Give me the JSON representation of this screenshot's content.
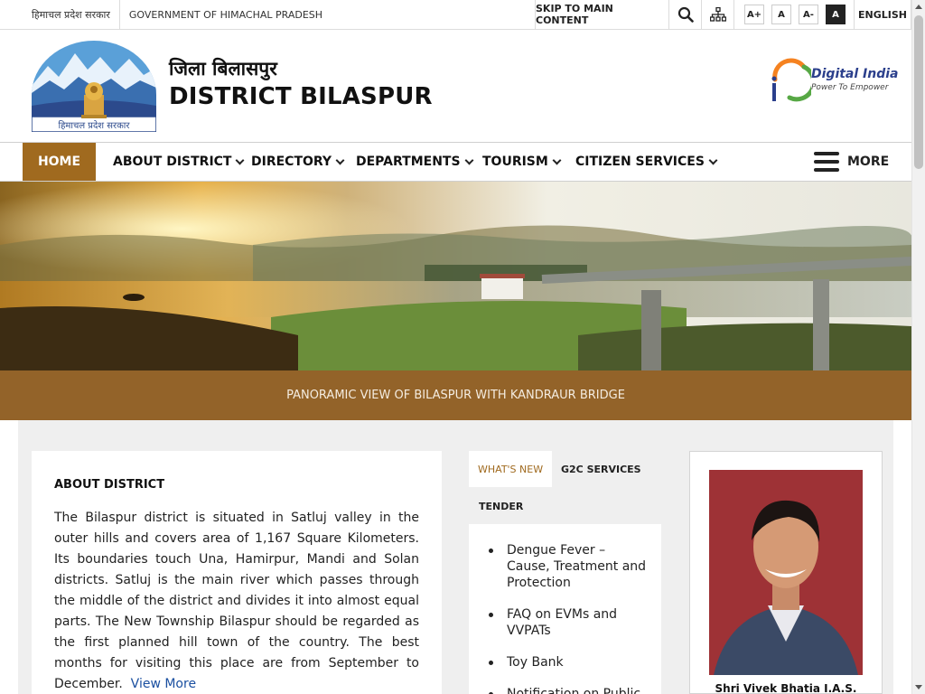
{
  "topbar": {
    "hp_govt_hindi": "हिमाचल प्रदेश सरकार",
    "govt_name": "GOVERNMENT OF HIMACHAL PRADESH",
    "skip_label": "SKIP TO MAIN CONTENT",
    "font_increase": "A+",
    "font_normal": "A",
    "font_decrease": "A-",
    "contrast": "A",
    "language": "ENGLISH"
  },
  "header": {
    "title_hindi": "जिला बिलासपुर",
    "title": "DISTRICT BILASPUR",
    "emblem_caption": "हिमाचल प्रदेश सरकार",
    "digital_india_title": "Digital India",
    "digital_india_tagline": "Power To Empower"
  },
  "nav": {
    "home": "HOME",
    "items": [
      "ABOUT DISTRICT",
      "DIRECTORY",
      "DEPARTMENTS",
      "TOURISM",
      "CITIZEN SERVICES"
    ],
    "more": "MORE"
  },
  "banner": {
    "caption": "PANORAMIC VIEW OF BILASPUR WITH KANDRAUR BRIDGE"
  },
  "about": {
    "heading": "ABOUT DISTRICT",
    "text": "The Bilaspur district is situated in Satluj valley in the outer hills and covers area of 1,167 Square Kilometers. Its boundaries touch Una, Hamirpur, Mandi and Solan districts. Satluj is the main river which passes through the middle of the district and divides it into almost equal parts. The New Township Bilaspur should be regarded as the first planned hill town of the country. The best months for visiting this place are from September to December.",
    "link": "View More"
  },
  "tabs": {
    "whats_new": "WHAT'S NEW",
    "g2c": "G2C SERVICES",
    "tender": "TENDER",
    "news": [
      "Dengue Fever – Cause, Treatment and Protection",
      "FAQ on EVMs and VVPATs",
      "Toy Bank",
      "Notification on Public"
    ]
  },
  "dc": {
    "name": "Shri Vivek Bhatia I.A.S."
  },
  "colors": {
    "accent": "#a06a1f",
    "caption_bg": "#936329",
    "link": "#1a4fa0"
  }
}
